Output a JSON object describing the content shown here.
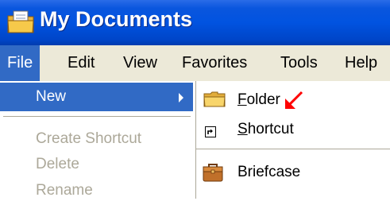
{
  "window": {
    "title": "My Documents",
    "icon": "folder-documents-icon"
  },
  "menubar": {
    "items": [
      "File",
      "Edit",
      "View",
      "Favorites",
      "Tools",
      "Help"
    ],
    "active": "File"
  },
  "file_menu": {
    "items": [
      {
        "label": "New",
        "state": "highlighted",
        "has_submenu": true
      },
      {
        "label": "Create Shortcut",
        "state": "disabled"
      },
      {
        "label": "Delete",
        "state": "disabled"
      },
      {
        "label": "Rename",
        "state": "disabled"
      }
    ]
  },
  "new_submenu": {
    "items": [
      {
        "label_first": "F",
        "label_rest": "older",
        "label": "Folder",
        "icon": "folder-icon"
      },
      {
        "label_first": "S",
        "label_rest": "hortcut",
        "label": "Shortcut",
        "icon": "shortcut-icon"
      },
      {
        "label": "Briefcase",
        "icon": "briefcase-icon"
      }
    ]
  },
  "annotation": {
    "icon": "red-arrow-icon",
    "color": "#ff0000"
  },
  "colors": {
    "title_bar": "#0153e0",
    "menu_highlight": "#316ac5",
    "menu_bar_bg": "#ece9d8",
    "disabled_text": "#aca899"
  }
}
